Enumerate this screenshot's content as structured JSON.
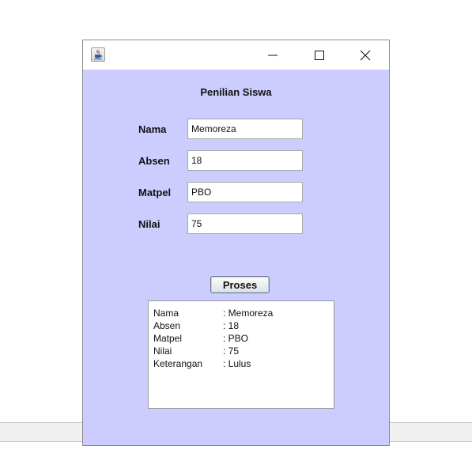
{
  "window": {
    "title": "",
    "icon": "java-cup-icon",
    "controls": [
      "minimize-icon",
      "maximize-icon",
      "close-icon"
    ]
  },
  "form": {
    "heading": "Penilian Siswa",
    "fields": [
      {
        "label": "Nama",
        "value": "Memoreza"
      },
      {
        "label": "Absen",
        "value": "18"
      },
      {
        "label": "Matpel",
        "value": "PBO"
      },
      {
        "label": "Nilai",
        "value": "75"
      }
    ],
    "process_label": "Proses"
  },
  "output": {
    "rows": [
      {
        "key": "Nama",
        "value": ": Memoreza"
      },
      {
        "key": "Absen",
        "value": ": 18"
      },
      {
        "key": "Matpel",
        "value": ": PBO"
      },
      {
        "key": "Nilai",
        "value": ": 75"
      },
      {
        "key": "Keterangan",
        "value": ": Lulus"
      }
    ]
  },
  "colors": {
    "panel_background": "#ccccff",
    "titlebar_background": "#ffffff"
  }
}
